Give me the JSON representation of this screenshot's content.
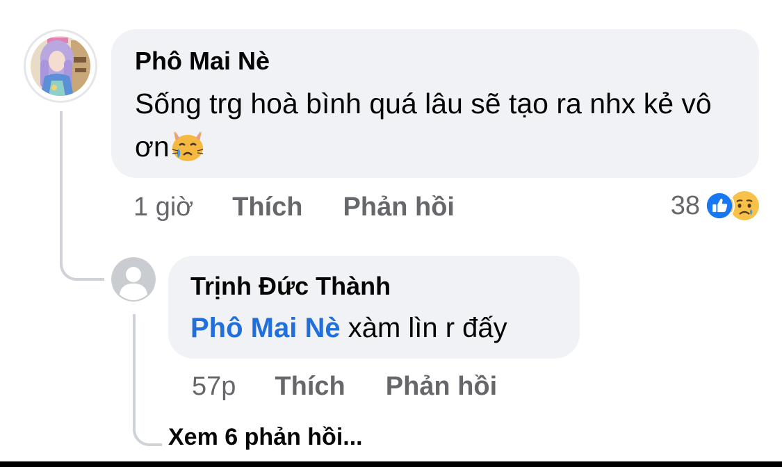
{
  "comment": {
    "author": "Phô Mai Nè",
    "text": "Sống trg hoà bình quá lâu sẽ tạo ra nhx kẻ vô ơn",
    "emoji_icon": "crying-cat-face",
    "time": "1 giờ",
    "like_label": "Thích",
    "reply_label": "Phản hồi",
    "reaction_count": "38",
    "reaction_icons": [
      "like",
      "sad"
    ]
  },
  "reply": {
    "author": "Trịnh Đức Thành",
    "mention": "Phô Mai Nè",
    "text": " xàm lìn r đấy",
    "time": "57p",
    "like_label": "Thích",
    "reply_label": "Phản hồi"
  },
  "view_more_replies": "Xem 6 phản hồi...",
  "colors": {
    "bubble_bg": "#f0f2f5",
    "mention": "#216fdb",
    "secondary_text": "#65676b",
    "like_blue": "#1877f2",
    "thread_line": "#cfd2d6"
  }
}
